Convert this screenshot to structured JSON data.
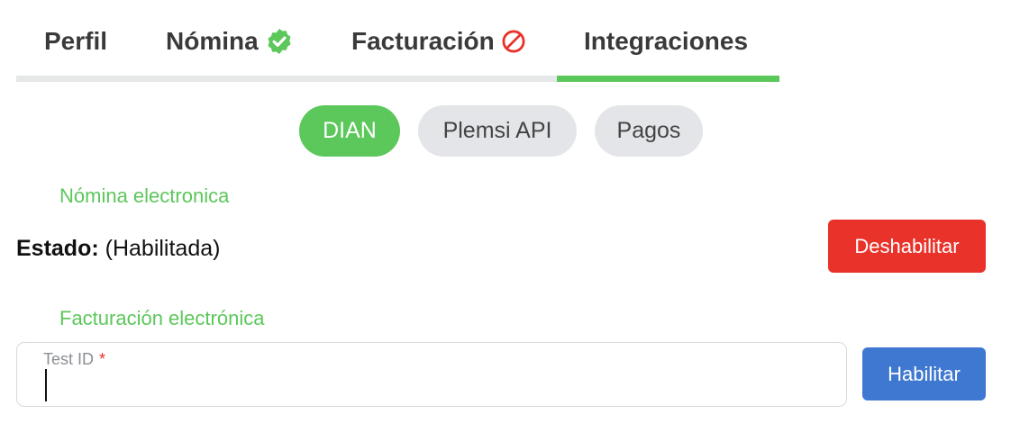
{
  "tabs": [
    {
      "label": "Perfil",
      "icon": "none"
    },
    {
      "label": "Nómina",
      "icon": "verified-check-icon",
      "icon_color": "#5cc75a"
    },
    {
      "label": "Facturación",
      "icon": "prohibited-icon",
      "icon_color": "#e8322a"
    },
    {
      "label": "Integraciones",
      "icon": "none",
      "active": true
    }
  ],
  "subtabs": [
    {
      "label": "DIAN",
      "active": true
    },
    {
      "label": "Plemsi API",
      "active": false
    },
    {
      "label": "Pagos",
      "active": false
    }
  ],
  "nomina": {
    "section_title": "Nómina electronica",
    "status_key": "Estado:",
    "status_value": "(Habilitada)",
    "action_label": "Deshabilitar"
  },
  "facturacion": {
    "section_title": "Facturación electrónica",
    "field_label": "Test ID",
    "required_mark": "*",
    "field_value": "",
    "action_label": "Habilitar"
  },
  "colors": {
    "accent": "#5cc75a",
    "danger": "#e8322a",
    "primary": "#3f78d1",
    "pill_inactive": "#e3e5e8"
  }
}
